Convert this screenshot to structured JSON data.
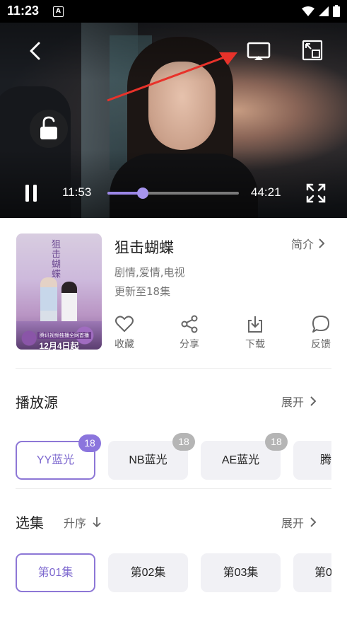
{
  "status_bar": {
    "time": "11:23",
    "notification_letter": "A"
  },
  "player": {
    "current_time": "11:53",
    "total_time": "44:21",
    "progress": 0.27,
    "accent_color": "#9b86e6"
  },
  "show": {
    "title": "狙击蝴蝶",
    "genre": "剧情,爱情,电视",
    "update_status": "更新至18集",
    "intro_label": "简介",
    "poster": {
      "title_text": "狙击蝴蝶",
      "tagline": "腾讯视频独播全网首播",
      "release_date": "12月4日起"
    }
  },
  "actions": [
    {
      "label": "收藏",
      "icon": "heart-icon"
    },
    {
      "label": "分享",
      "icon": "share-icon"
    },
    {
      "label": "下载",
      "icon": "download-icon"
    },
    {
      "label": "反馈",
      "icon": "feedback-icon"
    }
  ],
  "sources": {
    "title": "播放源",
    "expand_label": "展开",
    "items": [
      {
        "label": "YY蓝光",
        "count": "18",
        "active": true
      },
      {
        "label": "NB蓝光",
        "count": "18",
        "active": false
      },
      {
        "label": "AE蓝光",
        "count": "18",
        "active": false
      },
      {
        "label": "腾",
        "count": "",
        "active": false
      }
    ]
  },
  "episodes": {
    "title": "选集",
    "sort_label": "升序",
    "expand_label": "展开",
    "items": [
      {
        "label": "第01集",
        "active": true
      },
      {
        "label": "第02集",
        "active": false
      },
      {
        "label": "第03集",
        "active": false
      },
      {
        "label": "第0",
        "active": false
      }
    ]
  }
}
